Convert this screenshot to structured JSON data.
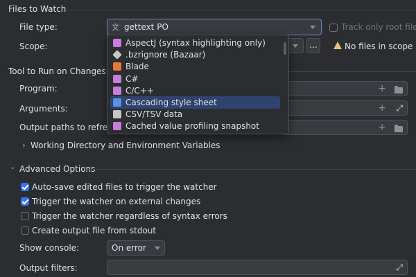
{
  "sections": {
    "files_to_watch": "Files to Watch",
    "tool_to_run": "Tool to Run on Changes",
    "advanced_options": "Advanced Options"
  },
  "file_type": {
    "label": "File type:",
    "value": "gettext PO",
    "track_only_root": "Track only root files"
  },
  "scope": {
    "label": "Scope:",
    "more_button": "...",
    "warning": "No files in scope"
  },
  "tool": {
    "program_label": "Program:",
    "arguments_label": "Arguments:",
    "output_paths_label": "Output paths to refresh:",
    "working_dir_label": "Working Directory and Environment Variables"
  },
  "dropdown": {
    "items": [
      {
        "label": "AspectJ (syntax highlighting only)",
        "icon": "aspectj-icon",
        "color": "#c77dda"
      },
      {
        "label": ".bzrignore (Bazaar)",
        "icon": "bazaar-icon",
        "color": "#c7c7c7"
      },
      {
        "label": "Blade",
        "icon": "blade-icon",
        "color": "#e8773a"
      },
      {
        "label": "C#",
        "icon": "csharp-icon",
        "color": "#c77dda"
      },
      {
        "label": "C/C++",
        "icon": "cpp-icon",
        "color": "#c77dda"
      },
      {
        "label": "Cascading style sheet",
        "icon": "css-icon",
        "color": "#5c8fe6"
      },
      {
        "label": "CSV/TSV data",
        "icon": "csv-icon",
        "color": "#c7c7c7"
      },
      {
        "label": "Cached value profiling snapshot",
        "icon": "snapshot-icon",
        "color": "#c77dda"
      }
    ],
    "selected": "Cascading style sheet"
  },
  "advanced": {
    "options": [
      {
        "label": "Auto-save edited files to trigger the watcher",
        "checked": true
      },
      {
        "label": "Trigger the watcher on external changes",
        "checked": true
      },
      {
        "label": "Trigger the watcher regardless of syntax errors",
        "checked": false
      },
      {
        "label": "Create output file from stdout",
        "checked": false
      }
    ],
    "show_console_label": "Show console:",
    "show_console_value": "On error",
    "output_filters_label": "Output filters:"
  },
  "colors": {
    "background": "#2b2d30",
    "accent": "#3574f0",
    "selection": "#2e436e",
    "warning": "#e5c07b"
  }
}
